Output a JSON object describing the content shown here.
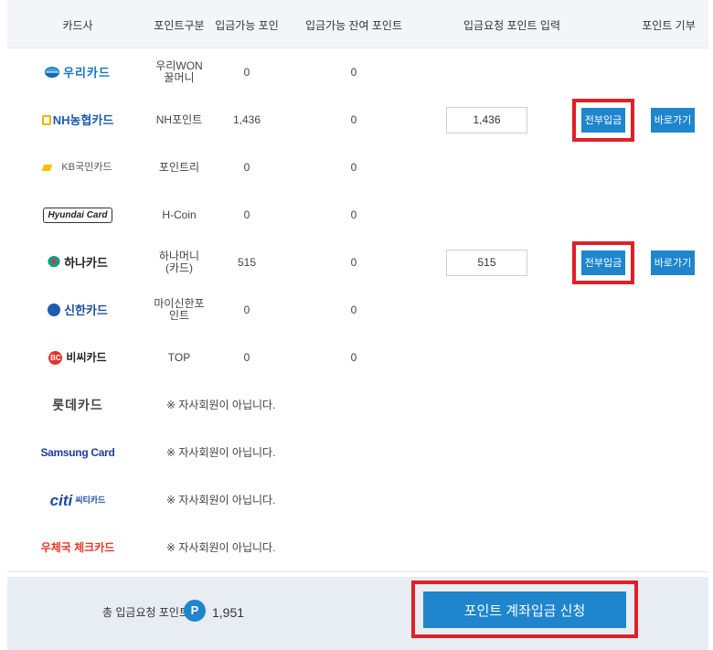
{
  "header": {
    "card_company": "카드사",
    "point_type": "포인트구분",
    "available": "입금가능 포인트",
    "remaining": "입금가능 잔여 포인트",
    "request_input": "입금요청 포인트 입력",
    "donate": "포인트 기부"
  },
  "rows": [
    {
      "logo": "우리카드",
      "type": "우리WON\n꿀머니",
      "available": "0",
      "remaining": "0"
    },
    {
      "logo": "NH농협카드",
      "type": "NH포인트",
      "available": "1,436",
      "remaining": "0",
      "input_value": "1,436",
      "all_label": "전부입금",
      "go_label": "바로가기"
    },
    {
      "logo": "KB국민카드",
      "type": "포인트리",
      "available": "0",
      "remaining": "0"
    },
    {
      "logo": "Hyundai Card",
      "type": "H-Coin",
      "available": "0",
      "remaining": "0"
    },
    {
      "logo": "하나카드",
      "type": "하나머니\n(카드)",
      "available": "515",
      "remaining": "0",
      "input_value": "515",
      "all_label": "전부입금",
      "go_label": "바로가기"
    },
    {
      "logo": "신한카드",
      "type": "마이신한포\n인트",
      "available": "0",
      "remaining": "0"
    },
    {
      "logo": "비씨카드",
      "type": "TOP",
      "available": "0",
      "remaining": "0"
    },
    {
      "logo": "롯데카드",
      "notice": "※ 자사회원이 아닙니다."
    },
    {
      "logo": "Samsung Card",
      "notice": "※ 자사회원이 아닙니다."
    },
    {
      "logo": "citi",
      "logo_sub": "씨티카드",
      "notice": "※ 자사회원이 아닙니다."
    },
    {
      "logo": "우체국 체크카드",
      "notice": "※ 자사회원이 아닙니다."
    }
  ],
  "footer": {
    "total_label": "총 입금요청 포인트",
    "badge": "P",
    "total_value": "1,951",
    "submit_label": "포인트 계좌입금 신청"
  },
  "colors": {
    "accent": "#1f85cd",
    "highlight": "#e01f27",
    "header_bg": "#f3f5f9",
    "footer_bg": "#e8edf4"
  }
}
